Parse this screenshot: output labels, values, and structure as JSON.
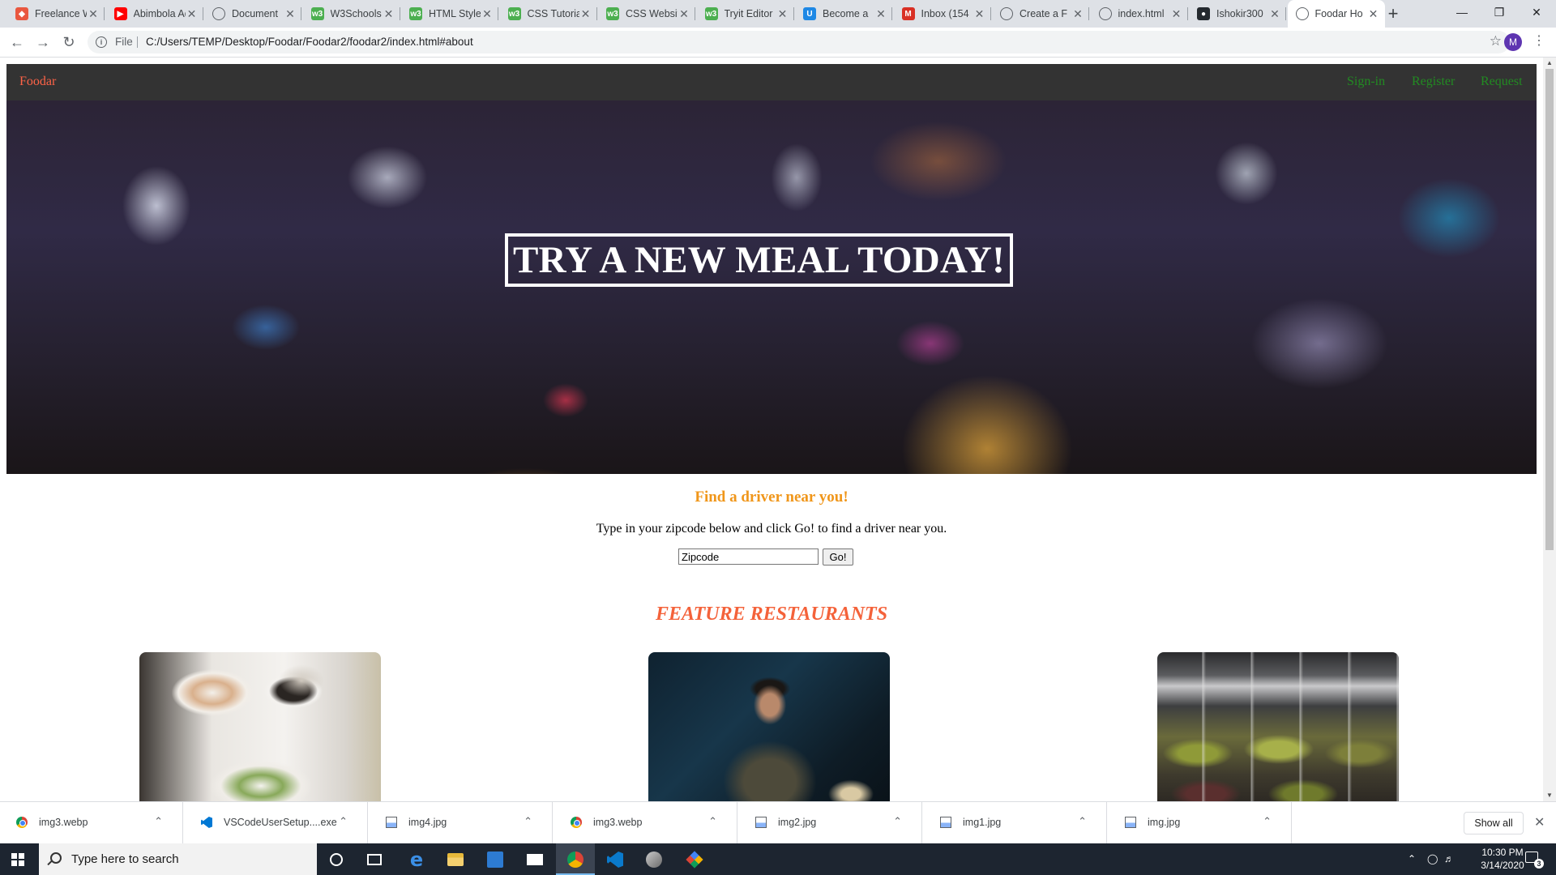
{
  "browser": {
    "tabs": [
      {
        "label": "Freelance Web",
        "icon": "freelancer-icon",
        "color": "#e9573f"
      },
      {
        "label": "Abimbola Ade",
        "icon": "youtube-icon",
        "color": "#ff0000"
      },
      {
        "label": "Document",
        "icon": "globe-icon",
        "color": "#5f6368"
      },
      {
        "label": "W3Schools",
        "icon": "w3schools-icon",
        "color": "#4caf50"
      },
      {
        "label": "HTML Styles",
        "icon": "w3schools-icon",
        "color": "#4caf50"
      },
      {
        "label": "CSS Tutorial",
        "icon": "w3schools-icon",
        "color": "#4caf50"
      },
      {
        "label": "CSS Website",
        "icon": "w3schools-icon",
        "color": "#4caf50"
      },
      {
        "label": "Tryit Editor",
        "icon": "w3schools-icon",
        "color": "#4caf50"
      },
      {
        "label": "Become a",
        "icon": "upwork-icon",
        "color": "#1e88e5"
      },
      {
        "label": "Inbox (154",
        "icon": "gmail-icon",
        "color": "#d93025"
      },
      {
        "label": "Create a F",
        "icon": "document-icon",
        "color": "#5f6368"
      },
      {
        "label": "index.html",
        "icon": "globe-icon",
        "color": "#5f6368"
      },
      {
        "label": "Ishokir300",
        "icon": "github-icon",
        "color": "#24292e"
      },
      {
        "label": "Foodar Ho",
        "icon": "globe-icon",
        "color": "#5f6368",
        "active": true
      }
    ],
    "new_tab": "+",
    "address": {
      "security_label": "File",
      "url": "C:/Users/TEMP/Desktop/Foodar/Foodar2/foodar2/index.html#about"
    },
    "profile_initial": "M"
  },
  "site": {
    "brand": "Foodar",
    "nav_links": [
      "Sign-in",
      "Register",
      "Request"
    ],
    "hero_title": "TRY A NEW MEAL TODAY!",
    "find_heading": "Find a driver near you!",
    "find_text": "Type in your zipcode below and click Go! to find a driver near you.",
    "zip_value": "Zipcode",
    "go_label": "Go!",
    "feature_heading": "FEATURE RESTAURANTS",
    "colors": {
      "nav_bg": "#333333",
      "brand": "#ff6347",
      "nav_link": "#228b22",
      "find_heading": "#f0961a",
      "feature_heading": "#f4623a"
    }
  },
  "downloads": {
    "items": [
      {
        "name": "img3.webp",
        "icon": "chrome-icon"
      },
      {
        "name": "VSCodeUserSetup....exe",
        "icon": "vscode-icon"
      },
      {
        "name": "img4.jpg",
        "icon": "image-file-icon"
      },
      {
        "name": "img3.webp",
        "icon": "chrome-icon"
      },
      {
        "name": "img2.jpg",
        "icon": "image-file-icon"
      },
      {
        "name": "img1.jpg",
        "icon": "image-file-icon"
      },
      {
        "name": "img.jpg",
        "icon": "image-file-icon"
      }
    ],
    "show_all": "Show all"
  },
  "taskbar": {
    "search_placeholder": "Type here to search",
    "time": "10:30 PM",
    "date": "3/14/2020",
    "notification_count": "3"
  }
}
